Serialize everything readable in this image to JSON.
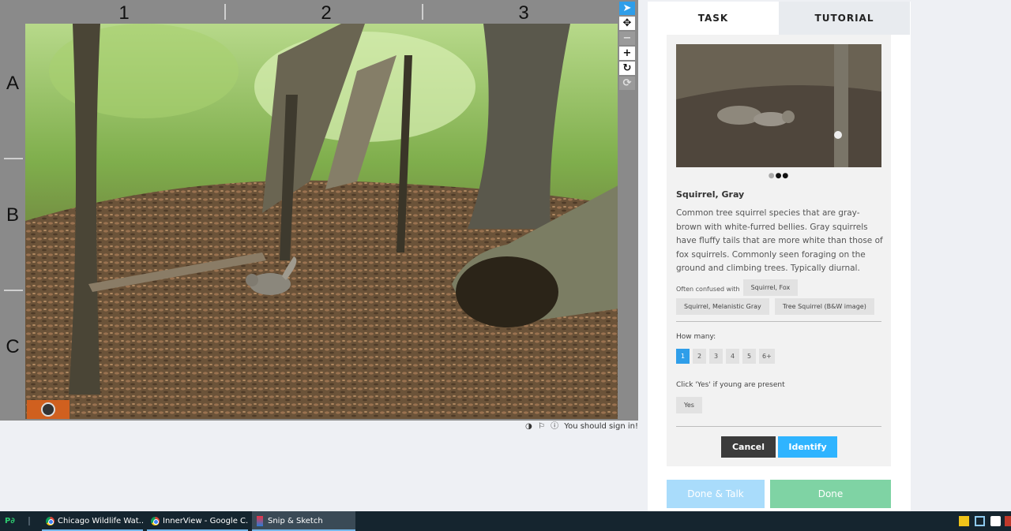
{
  "grid": {
    "columns": [
      "1",
      "2",
      "3"
    ],
    "rows": [
      "A",
      "B",
      "C"
    ]
  },
  "tools": [
    {
      "name": "pointer",
      "glyph": "➤",
      "state": "active"
    },
    {
      "name": "move",
      "glyph": "✥",
      "state": "normal"
    },
    {
      "name": "zoom-out",
      "glyph": "−",
      "state": "disabled"
    },
    {
      "name": "zoom-in",
      "glyph": "+",
      "state": "normal"
    },
    {
      "name": "rotate",
      "glyph": "↻",
      "state": "normal"
    },
    {
      "name": "reset",
      "glyph": "⟳",
      "state": "disabled"
    }
  ],
  "viewer_footer": {
    "sign_in": "You should sign in!"
  },
  "tabs": {
    "task": "TASK",
    "tutorial": "TUTORIAL"
  },
  "species": {
    "name": "Squirrel, Gray",
    "description": "Common tree squirrel species that are gray-brown with white-furred bellies. Gray squirrels have fluffy tails that are more white than those of fox squirrels. Commonly seen foraging on the ground and climbing trees. Typically diurnal.",
    "confused_label": "Often confused with",
    "confused": [
      "Squirrel, Fox",
      "Squirrel, Melanistic Gray",
      "Tree Squirrel (B&W image)"
    ]
  },
  "how_many": {
    "label": "How many:",
    "options": [
      "1",
      "2",
      "3",
      "4",
      "5",
      "6+"
    ],
    "selected": "1"
  },
  "young": {
    "label": "Click 'Yes' if young are present",
    "yes": "Yes"
  },
  "buttons": {
    "cancel": "Cancel",
    "identify": "Identify",
    "done_talk": "Done & Talk",
    "done": "Done"
  },
  "colors": {
    "accent": "#2f9ee9",
    "identify": "#2fb4ff",
    "done": "#7fd3a4",
    "done_talk": "#a9dcfb",
    "taskbar": "#15252f"
  },
  "taskbar": {
    "items": [
      {
        "label": "Chicago Wildlife Wat...",
        "icon": "chrome-icon"
      },
      {
        "label": "InnerView - Google C...",
        "icon": "chrome-icon"
      },
      {
        "label": "Snip & Sketch",
        "icon": "snip-sketch-icon"
      }
    ]
  }
}
